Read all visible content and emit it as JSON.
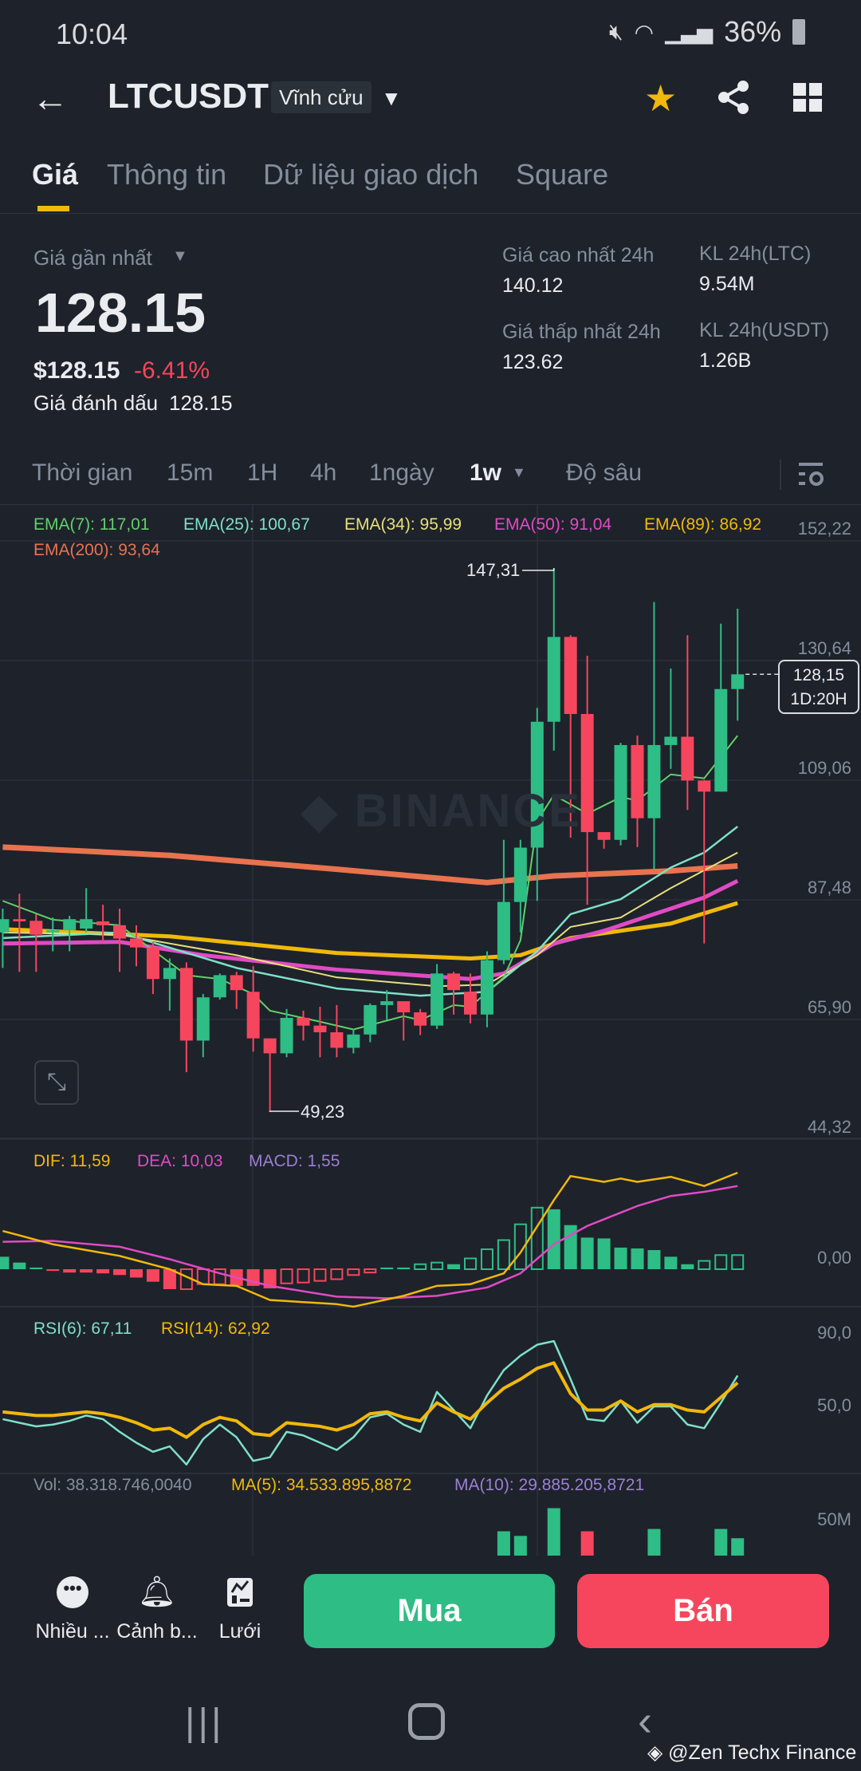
{
  "status_bar": {
    "time": "10:04",
    "battery": "36%"
  },
  "header": {
    "symbol": "LTCUSDT",
    "contract_type": "Vĩnh cửu"
  },
  "tabs": [
    {
      "label": "Giá",
      "active": true
    },
    {
      "label": "Thông tin"
    },
    {
      "label": "Dữ liệu giao dịch"
    },
    {
      "label": "Square"
    }
  ],
  "ticker": {
    "last_price_label": "Giá gần nhất",
    "last_price": "128.15",
    "usd_price": "$128.15",
    "change_pct": "-6.41%",
    "mark_price_label": "Giá đánh dấu",
    "mark_price": "128.15",
    "high_label": "Giá cao nhất 24h",
    "high": "140.12",
    "low_label": "Giá thấp nhất 24h",
    "low": "123.62",
    "vol_ltc_label": "KL 24h(LTC)",
    "vol_ltc": "9.54M",
    "vol_usdt_label": "KL 24h(USDT)",
    "vol_usdt": "1.26B"
  },
  "intervals": {
    "time_label": "Thời gian",
    "items": [
      "15m",
      "1H",
      "4h",
      "1ngày",
      "1w"
    ],
    "active": "1w",
    "depth_label": "Độ sâu"
  },
  "colors": {
    "up": "#2ebd85",
    "down": "#f6465d",
    "accent": "#f0b90b",
    "bg": "#1e222b"
  },
  "chart_data": {
    "type": "candlestick",
    "interval": "1w",
    "watermark": "BINANCE",
    "y_ticks": [
      "152,22",
      "130,64",
      "109,06",
      "87,48",
      "65,90",
      "44,32"
    ],
    "ylim": [
      44.32,
      152.22
    ],
    "max_label": "147,31",
    "min_label": "49,23",
    "last_price_tag": "128,15",
    "countdown": "1D:20H",
    "ema_legend": [
      {
        "label": "EMA(7): 117,01",
        "color": "#5fd068"
      },
      {
        "label": "EMA(25): 100,67",
        "color": "#7ee0c8"
      },
      {
        "label": "EMA(34): 95,99",
        "color": "#e6e07a"
      },
      {
        "label": "EMA(50): 91,04",
        "color": "#e04bc4"
      },
      {
        "label": "EMA(89): 86,92",
        "color": "#f0b90b"
      },
      {
        "label": "EMA(200): 93,64",
        "color": "#e8734e"
      }
    ],
    "candles_ohlc": [
      [
        81.6,
        85.9,
        75.2,
        84.0
      ],
      [
        84.0,
        88.6,
        74.5,
        83.6
      ],
      [
        83.7,
        84.9,
        74.5,
        81.2
      ],
      [
        81.6,
        84.3,
        78.2,
        82.0
      ],
      [
        82.0,
        84.6,
        78.2,
        84.0
      ],
      [
        82.3,
        89.6,
        81.6,
        84.0
      ],
      [
        83.6,
        86.6,
        79.9,
        82.9
      ],
      [
        82.9,
        85.9,
        74.5,
        80.5
      ],
      [
        80.5,
        82.9,
        75.5,
        78.9
      ],
      [
        78.9,
        79.9,
        70.5,
        73.2
      ],
      [
        73.2,
        76.9,
        67.5,
        75.2
      ],
      [
        75.2,
        76.2,
        56.4,
        62.1
      ],
      [
        62.1,
        70.5,
        59.1,
        69.9
      ],
      [
        69.9,
        74.2,
        69.5,
        73.9
      ],
      [
        73.9,
        74.5,
        67.8,
        71.2
      ],
      [
        70.9,
        75.5,
        60.1,
        62.5
      ],
      [
        62.5,
        62.5,
        49.23,
        59.8
      ],
      [
        59.8,
        67.8,
        59.1,
        66.2
      ],
      [
        66.2,
        67.5,
        62.1,
        64.8
      ],
      [
        64.8,
        68.2,
        59.1,
        63.6
      ],
      [
        63.6,
        68.5,
        59.1,
        60.8
      ],
      [
        60.8,
        64.2,
        59.8,
        63.2
      ],
      [
        63.2,
        68.8,
        61.8,
        68.5
      ],
      [
        68.5,
        71.2,
        65.8,
        69.2
      ],
      [
        69.2,
        69.2,
        62.1,
        67.2
      ],
      [
        67.2,
        67.8,
        63.1,
        64.8
      ],
      [
        64.8,
        75.9,
        64.2,
        74.2
      ],
      [
        74.2,
        74.5,
        66.8,
        71.2
      ],
      [
        70.9,
        74.2,
        65.2,
        66.8
      ],
      [
        66.8,
        78.2,
        64.5,
        76.6
      ],
      [
        76.6,
        98.3,
        75.9,
        87.1
      ],
      [
        87.1,
        98.3,
        81.6,
        96.9
      ],
      [
        96.9,
        122.1,
        87.3,
        119.6
      ],
      [
        119.6,
        147.31,
        114.4,
        134.9
      ],
      [
        134.9,
        135.2,
        98.7,
        121.0
      ],
      [
        121.0,
        131.5,
        86.6,
        99.7
      ],
      [
        99.7,
        99.7,
        96.7,
        98.3
      ],
      [
        98.3,
        115.8,
        97.3,
        115.4
      ],
      [
        115.4,
        117.1,
        97.0,
        102.2
      ],
      [
        102.2,
        141.2,
        93.0,
        115.4
      ],
      [
        115.4,
        129.2,
        111.1,
        116.9
      ],
      [
        116.9,
        135.2,
        103.7,
        109.0
      ],
      [
        109.0,
        109.1,
        79.6,
        107.0
      ],
      [
        107.0,
        137.3,
        107.0,
        125.5
      ],
      [
        125.5,
        140.0,
        119.8,
        128.15
      ]
    ],
    "ema_series": [
      {
        "name": "EMA(7)",
        "color": "#5fd068",
        "width": 2,
        "anchors": [
          [
            0,
            87.3
          ],
          [
            3,
            83.9
          ],
          [
            7,
            82.9
          ],
          [
            11,
            73.9
          ],
          [
            13,
            73.2
          ],
          [
            15,
            70.5
          ],
          [
            16,
            67.5
          ],
          [
            19,
            65.5
          ],
          [
            21,
            64.1
          ],
          [
            24,
            66.5
          ],
          [
            25,
            65.8
          ],
          [
            27,
            68.5
          ],
          [
            28,
            68.2
          ],
          [
            30,
            73.5
          ],
          [
            31,
            80.2
          ],
          [
            32,
            101.7
          ],
          [
            33,
            106.4
          ],
          [
            35,
            103.0
          ],
          [
            37,
            106.0
          ],
          [
            38,
            105.4
          ],
          [
            40,
            110.1
          ],
          [
            42,
            109.4
          ],
          [
            44,
            117.1
          ]
        ]
      },
      {
        "name": "EMA(25)",
        "color": "#7ee0c8",
        "width": 2.5,
        "anchors": [
          [
            0,
            80.6
          ],
          [
            7,
            81.6
          ],
          [
            14,
            75.2
          ],
          [
            20,
            71.5
          ],
          [
            25,
            70.2
          ],
          [
            29,
            70.9
          ],
          [
            32,
            78.2
          ],
          [
            34,
            84.9
          ],
          [
            37,
            87.6
          ],
          [
            40,
            93.3
          ],
          [
            42,
            96.0
          ],
          [
            44,
            100.7
          ]
        ]
      },
      {
        "name": "EMA(34)",
        "color": "#e6e07a",
        "width": 2,
        "anchors": [
          [
            0,
            81.6
          ],
          [
            7,
            81.2
          ],
          [
            14,
            77.5
          ],
          [
            20,
            73.5
          ],
          [
            26,
            71.9
          ],
          [
            29,
            72.2
          ],
          [
            32,
            77.5
          ],
          [
            34,
            82.6
          ],
          [
            37,
            84.3
          ],
          [
            40,
            89.6
          ],
          [
            44,
            96.0
          ]
        ]
      },
      {
        "name": "EMA(50)",
        "color": "#e04bc4",
        "width": 5,
        "anchors": [
          [
            0,
            79.6
          ],
          [
            7,
            79.9
          ],
          [
            12,
            77.5
          ],
          [
            20,
            74.9
          ],
          [
            28,
            73.2
          ],
          [
            30,
            74.2
          ],
          [
            33,
            79.6
          ],
          [
            36,
            81.9
          ],
          [
            40,
            85.9
          ],
          [
            42,
            87.9
          ],
          [
            44,
            90.9
          ]
        ]
      },
      {
        "name": "EMA(89)",
        "color": "#f0b90b",
        "width": 5,
        "anchors": [
          [
            0,
            82.2
          ],
          [
            10,
            80.9
          ],
          [
            20,
            77.9
          ],
          [
            28,
            76.9
          ],
          [
            31,
            77.5
          ],
          [
            34,
            80.6
          ],
          [
            40,
            83.2
          ],
          [
            44,
            86.9
          ]
        ]
      },
      {
        "name": "EMA(200)",
        "color": "#e8734e",
        "width": 7,
        "anchors": [
          [
            0,
            97.0
          ],
          [
            10,
            95.5
          ],
          [
            20,
            93.0
          ],
          [
            29,
            90.6
          ],
          [
            33,
            91.8
          ],
          [
            40,
            92.7
          ],
          [
            44,
            93.6
          ]
        ]
      }
    ],
    "macd": {
      "legend": [
        {
          "label": "DIF: 11,59",
          "color": "#f0b90b"
        },
        {
          "label": "DEA: 10,03",
          "color": "#e04bc4"
        },
        {
          "label": "MACD: 1,55",
          "color": "#9b7fd4"
        }
      ],
      "zero_label": "0,00",
      "histogram": [
        1.5,
        0.8,
        0.2,
        -0.2,
        -0.4,
        -0.4,
        -0.5,
        -0.7,
        -1.0,
        -1.5,
        -2.4,
        -2.4,
        -1.8,
        -1.8,
        -2.0,
        -2.0,
        -2.3,
        -1.7,
        -1.6,
        -1.4,
        -1.2,
        -0.7,
        -0.4,
        0.2,
        0.2,
        0.6,
        0.8,
        0.6,
        1.3,
        2.4,
        3.5,
        5.4,
        7.4,
        7.2,
        5.3,
        3.8,
        3.7,
        2.6,
        2.5,
        2.3,
        1.5,
        0.6,
        1.0,
        1.7,
        1.7
      ],
      "hollow": [
        0,
        0,
        0,
        0,
        0,
        0,
        0,
        0,
        0,
        0,
        0,
        1,
        1,
        1,
        0,
        0,
        0,
        1,
        1,
        1,
        1,
        1,
        1,
        0,
        0,
        1,
        1,
        0,
        1,
        1,
        1,
        1,
        1,
        0,
        0,
        0,
        0,
        0,
        0,
        0,
        0,
        0,
        1,
        1,
        1
      ],
      "dif_anchors": [
        [
          0,
          4.6
        ],
        [
          3,
          3.0
        ],
        [
          7,
          1.6
        ],
        [
          10,
          0.0
        ],
        [
          12,
          -1.8
        ],
        [
          14,
          -2.0
        ],
        [
          16,
          -3.7
        ],
        [
          20,
          -4.2
        ],
        [
          21,
          -4.5
        ],
        [
          24,
          -3.2
        ],
        [
          26,
          -2.0
        ],
        [
          28,
          -1.8
        ],
        [
          30,
          -0.5
        ],
        [
          31,
          2.0
        ],
        [
          33,
          8.3
        ],
        [
          34,
          11.2
        ],
        [
          36,
          10.5
        ],
        [
          37,
          10.9
        ],
        [
          38,
          10.5
        ],
        [
          40,
          11.1
        ],
        [
          42,
          10.0
        ],
        [
          44,
          11.6
        ]
      ],
      "dea_anchors": [
        [
          0,
          3.3
        ],
        [
          3,
          3.4
        ],
        [
          7,
          2.7
        ],
        [
          10,
          1.2
        ],
        [
          13,
          -0.5
        ],
        [
          16,
          -2.0
        ],
        [
          20,
          -3.3
        ],
        [
          23,
          -3.5
        ],
        [
          26,
          -3.2
        ],
        [
          29,
          -2.2
        ],
        [
          31,
          -0.5
        ],
        [
          33,
          3.0
        ],
        [
          35,
          5.2
        ],
        [
          38,
          7.6
        ],
        [
          40,
          8.8
        ],
        [
          42,
          9.3
        ],
        [
          44,
          10.0
        ]
      ]
    },
    "rsi": {
      "legend": [
        {
          "label": "RSI(6): 67,11",
          "color": "#7ee0c8"
        },
        {
          "label": "RSI(14): 62,92",
          "color": "#f0b90b"
        }
      ],
      "ticks": [
        "90,0",
        "50,0"
      ],
      "rsi6": [
        43,
        41,
        39,
        40,
        42,
        45,
        43,
        36,
        30,
        25,
        28,
        18,
        32,
        40,
        33,
        20,
        22,
        36,
        34,
        30,
        26,
        33,
        44,
        46,
        40,
        36,
        58,
        48,
        38,
        56,
        70,
        78,
        84,
        86,
        65,
        43,
        42,
        53,
        41,
        50,
        50,
        40,
        38,
        52,
        67
      ],
      "rsi14": [
        47,
        46,
        45,
        45,
        46,
        47,
        46,
        44,
        41,
        37,
        38,
        33,
        40,
        44,
        42,
        35,
        34,
        41,
        40,
        39,
        37,
        40,
        46,
        47,
        44,
        42,
        52,
        47,
        43,
        52,
        60,
        65,
        71,
        74,
        57,
        48,
        48,
        53,
        47,
        51,
        51,
        48,
        47,
        55,
        63
      ]
    },
    "volume": {
      "legend": [
        {
          "label": "Vol: 38.318.746,0040",
          "color": "#848e9c"
        },
        {
          "label": "MA(5): 34.533.895,8872",
          "color": "#f0b90b"
        },
        {
          "label": "MA(10): 29.885.205,8721",
          "color": "#9b7fd4"
        }
      ],
      "tick": "50M",
      "bars": [
        {
          "i": 30,
          "v": 45,
          "up": true
        },
        {
          "i": 31,
          "v": 43,
          "up": true
        },
        {
          "i": 33,
          "v": 55,
          "up": true
        },
        {
          "i": 35,
          "v": 45,
          "up": false
        },
        {
          "i": 39,
          "v": 46,
          "up": true
        },
        {
          "i": 43,
          "v": 46,
          "up": true
        },
        {
          "i": 44,
          "v": 42,
          "up": true
        }
      ]
    }
  },
  "toolbar": {
    "more_label": "Nhiều ...",
    "alert_label": "Cảnh b...",
    "grid_label": "Lưới",
    "buy_label": "Mua",
    "sell_label": "Bán"
  },
  "watermark_credit": "@Zen Techx Finance"
}
